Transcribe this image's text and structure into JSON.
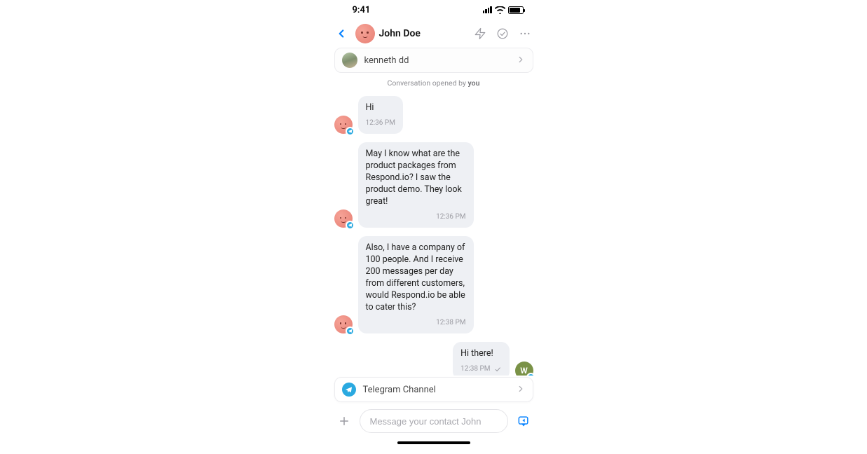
{
  "status": {
    "time": "9:41"
  },
  "header": {
    "contact_name": "John Doe"
  },
  "contact_pill": {
    "name": "kenneth dd"
  },
  "opened": {
    "prefix": "Conversation opened by ",
    "actor": "you"
  },
  "messages": [
    {
      "side": "left",
      "text": "Hi",
      "time": "12:36 PM"
    },
    {
      "side": "left",
      "text": "May I know what are the product packages from Respond.io? I saw the product demo. They look great!",
      "time": "12:36 PM"
    },
    {
      "side": "left",
      "text": "Also, I have a company of 100 people. And I receive 200 messages per day from different customers, would Respond.io be able to cater this?",
      "time": "12:38 PM"
    },
    {
      "side": "right",
      "text": "Hi there!",
      "time": "12:38 PM"
    }
  ],
  "agent": {
    "initial": "W"
  },
  "channel": {
    "label": "Telegram Channel"
  },
  "composer": {
    "placeholder": "Message your contact John"
  }
}
